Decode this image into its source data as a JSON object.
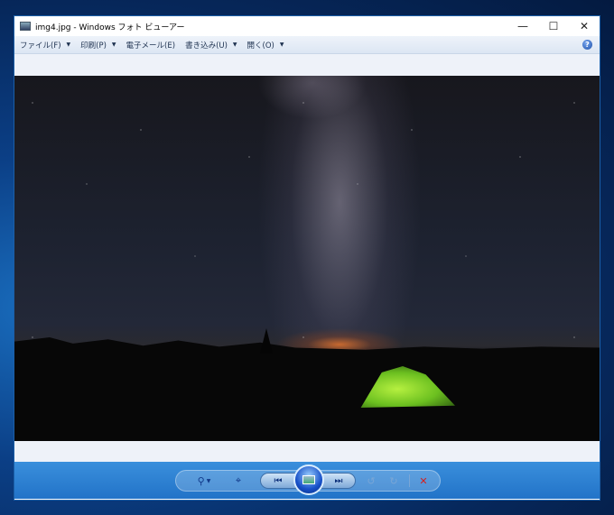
{
  "window": {
    "title": "img4.jpg - Windows フォト ビューアー"
  },
  "menu": [
    {
      "label": "ファイル(F)",
      "dropdown": true
    },
    {
      "label": "印刷(P)",
      "dropdown": true
    },
    {
      "label": "電子メール(E)",
      "dropdown": false
    },
    {
      "label": "書き込み(U)",
      "dropdown": true
    },
    {
      "label": "開く(O)",
      "dropdown": true
    }
  ],
  "icons": {
    "minimize": "—",
    "maximize": "☐",
    "close": "✕",
    "help": "?",
    "zoom": "⚲",
    "fit": "⌖",
    "prev": "⏮",
    "next": "⏭",
    "rotate_ccw": "↺",
    "rotate_cw": "↻",
    "delete": "✕",
    "dropdown": "▼"
  }
}
